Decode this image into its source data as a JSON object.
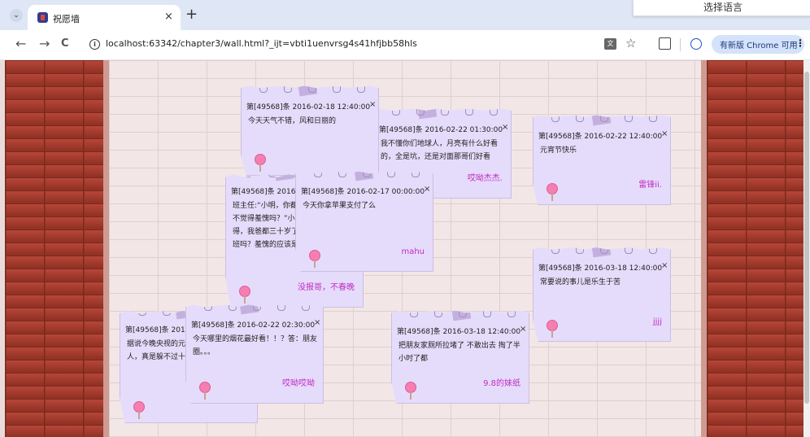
{
  "browser": {
    "tab_title": "祝愿墙",
    "tab_close": "×",
    "new_tab": "+",
    "language_popup": "选择语言",
    "url": "localhost:63342/chapter3/wall.html?_ijt=vbti1uenvrsg4s41hfjbb58hls",
    "update_label": "有新版 Chrome 可用",
    "menu_glyph": "⋮",
    "back": "←",
    "forward": "→",
    "reload": "C",
    "star": "☆",
    "translate": "文",
    "tab_menu": "⌄",
    "window_minimize": "—",
    "window_close": "×"
  },
  "notes": [
    {
      "id": "n1",
      "header": "第[49568]条 2016-02-18 12:40:00",
      "body": "今天天气不错，风和日丽的",
      "author": "",
      "close": "×"
    },
    {
      "id": "n2",
      "header": "第[49568]条 2016-02-22 01:30:00",
      "body": "我不懂你们地球人，月亮有什么好看的，全是坑，还是对面那哥们好看",
      "author": "哎呦杰杰.",
      "close": "×"
    },
    {
      "id": "n3",
      "header": "第[49568]条 2016-02-22 12:40:00",
      "body": "元宵节快乐",
      "author": "雷锋ii.",
      "close": "×"
    },
    {
      "id": "n4",
      "header": "第[49568]条 2016-02-22 08:00:00",
      "body": "班主任:“小明，你都已经上了三年级，不觉得羞愧吗？”小明:“一点也不觉得，我爸都三十岁了，不也是年年在上班吗？羞愧的应该是你吧。”",
      "author": "没报哥，不春晚",
      "close": "×"
    },
    {
      "id": "n5",
      "header": "第[49568]条 2016-02-17 00:00:00",
      "body": "今天你拿苹果支付了么",
      "author": "mahu",
      "close": "×"
    },
    {
      "id": "n6",
      "header": "第[49568]条 2016-03-18 12:40:00",
      "body": "常要说的事儿是乐生于苦",
      "author": "jjjj",
      "close": "×"
    },
    {
      "id": "n7",
      "header": "第[49568]条 2016-02-22 12:40:00",
      "body": "据说今晚央视的元宵晚会导演是同一个人，真是躲不过十五。",
      "author": "",
      "close": "×"
    },
    {
      "id": "n8",
      "header": "第[49568]条 2016-02-22 02:30:00",
      "body": "今天哪里的烟花最好看！！？答：朋友圈。。。",
      "author": "哎呦哎呦",
      "close": "×"
    },
    {
      "id": "n9",
      "header": "第[49568]条 2016-03-18 12:40:00",
      "body": "把朋友家厕所拉堵了 不敢出去 掏了半小时了都",
      "author": "9.8的妹纸",
      "close": "×"
    }
  ]
}
